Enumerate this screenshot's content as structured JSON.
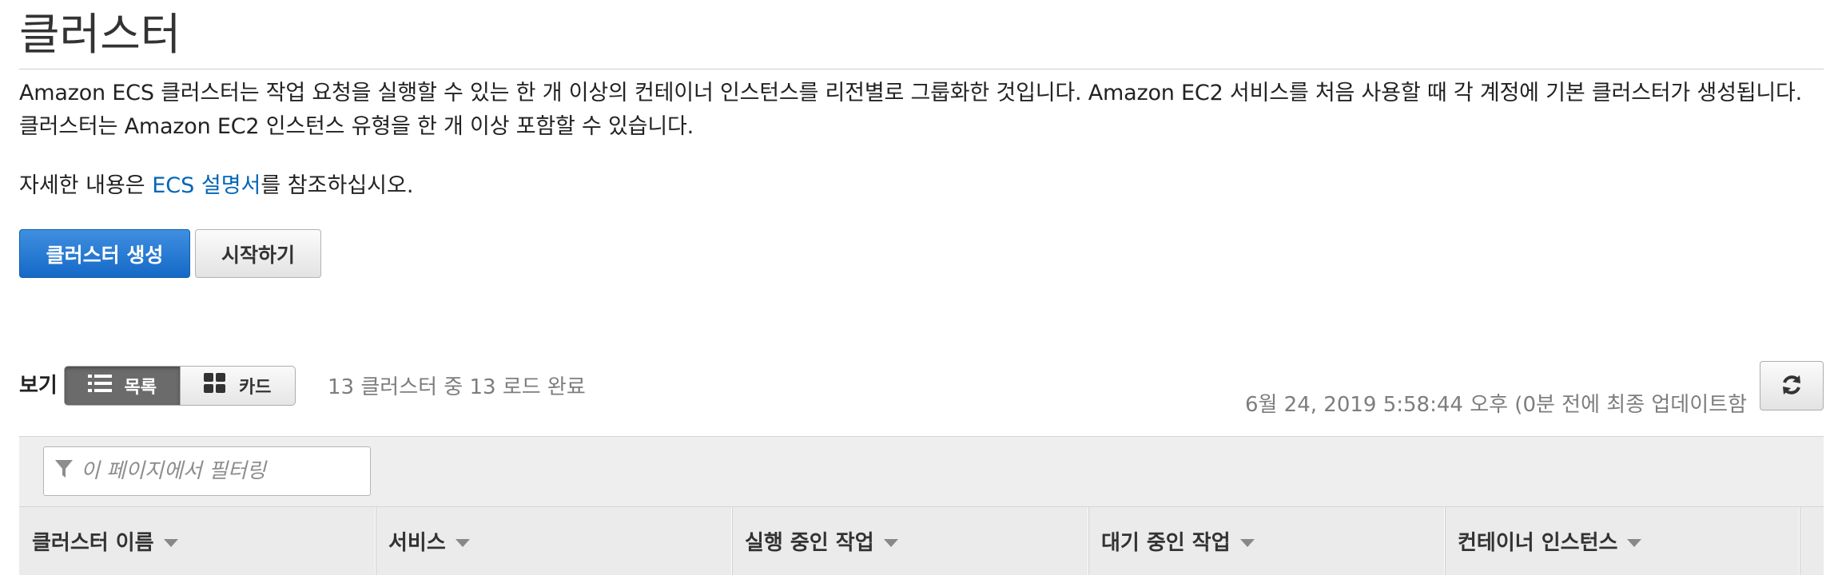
{
  "page": {
    "title": "클러스터",
    "description": "Amazon ECS 클러스터는 작업 요청을 실행할 수 있는 한 개 이상의 컨테이너 인스턴스를 리전별로 그룹화한 것입니다. Amazon EC2 서비스를 처음 사용할 때 각 계정에 기본 클러스터가 생성됩니다. 클러스터는 Amazon EC2 인스턴스 유형을 한 개 이상 포함할 수 있습니다.",
    "more_info_prefix": "자세한 내용은 ",
    "more_info_link": "ECS 설명서",
    "more_info_suffix": "를 참조하십시오."
  },
  "actions": {
    "create_cluster": "클러스터 생성",
    "get_started": "시작하기"
  },
  "view": {
    "label": "보기",
    "list": "목록",
    "card": "카드",
    "selected": "list"
  },
  "status": {
    "load": "13 클러스터 중 13 로드 완료",
    "updated": "6월 24, 2019 5:58:44 오후 (0분 전에 최종 업데이트함"
  },
  "filter": {
    "placeholder": "이 페이지에서 필터링"
  },
  "table": {
    "columns": [
      "클러스터 이름",
      "서비스",
      "실행 중인 작업",
      "대기 중인 작업",
      "컨테이너 인스턴스"
    ]
  },
  "icons": {
    "refresh": "refresh-icon",
    "list": "list-icon",
    "card": "grid-icon",
    "filter": "funnel-icon",
    "sort": "caret-down-icon"
  },
  "colors": {
    "primary": "#1569c7",
    "link": "#0066b8",
    "muted": "#7d7d7d",
    "toggle_active": "#6b6b6b"
  }
}
